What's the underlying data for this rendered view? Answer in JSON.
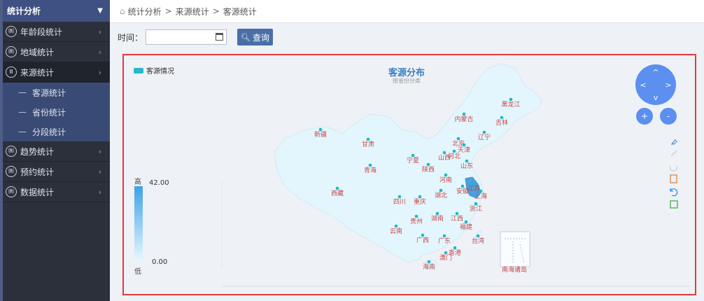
{
  "sidebar": {
    "header": "统计分析",
    "items": [
      {
        "label": "年龄段统计",
        "icon": "㈱"
      },
      {
        "label": "地域统计",
        "icon": "㈱"
      },
      {
        "label": "来源统计",
        "icon": "Ⅲ"
      },
      {
        "label": "趋势统计",
        "icon": "㈱"
      },
      {
        "label": "预约统计",
        "icon": "㈱"
      },
      {
        "label": "数据统计",
        "icon": "㈱"
      }
    ],
    "subitems": [
      "客源统计",
      "省份统计",
      "分段统计"
    ]
  },
  "breadcrumb": {
    "items": [
      "统计分析",
      "来源统计",
      "客源统计"
    ],
    "sep": ">"
  },
  "filter": {
    "time_label": "时间：",
    "date_value": "",
    "search_label": "查询"
  },
  "chart": {
    "title": "客源分布",
    "subtitle": "按省份分类",
    "legend": "客源情况",
    "vm_high": "高",
    "vm_low": "低",
    "vm_max": "42.00",
    "vm_min": "0.00",
    "nanhai_label": "南海诸岛"
  },
  "chart_data": {
    "type": "map",
    "series": [
      {
        "name": "客源情况"
      }
    ],
    "provinces": [
      "黑龙江",
      "吉林",
      "辽宁",
      "内蒙古",
      "北京",
      "天津",
      "河北",
      "山西",
      "山东",
      "宁夏",
      "甘肃",
      "新疆",
      "青海",
      "陕西",
      "河南",
      "西藏",
      "四川",
      "重庆",
      "湖北",
      "安徽",
      "江苏",
      "上海",
      "浙江",
      "贵州",
      "湖南",
      "江西",
      "福建",
      "云南",
      "广西",
      "广东",
      "台湾",
      "香港",
      "澳门",
      "海南"
    ],
    "highlight": "江苏",
    "visual_map": {
      "min": 0.0,
      "max": 42.0
    }
  }
}
